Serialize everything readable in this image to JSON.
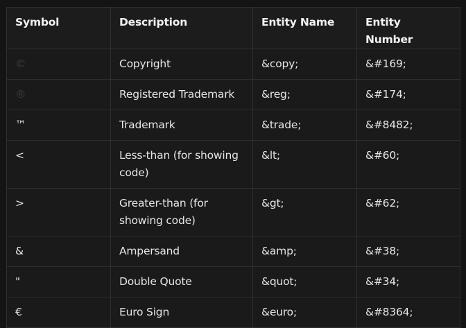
{
  "table": {
    "headers": [
      "Symbol",
      "Description",
      "Entity Name",
      "Entity Number"
    ],
    "rows": [
      {
        "symbol": "©",
        "description": "Copyright",
        "entity_name": "&copy;",
        "entity_number": "&#169;"
      },
      {
        "symbol": "®",
        "description": "Registered Trademark",
        "entity_name": "&reg;",
        "entity_number": "&#174;"
      },
      {
        "symbol": "™",
        "description": "Trademark",
        "entity_name": "&trade;",
        "entity_number": "&#8482;"
      },
      {
        "symbol": "<",
        "description": "Less-than (for showing code)",
        "entity_name": "&lt;",
        "entity_number": "&#60;"
      },
      {
        "symbol": ">",
        "description": "Greater-than (for showing code)",
        "entity_name": "&gt;",
        "entity_number": "&#62;"
      },
      {
        "symbol": "&",
        "description": "Ampersand",
        "entity_name": "&amp;",
        "entity_number": "&#38;"
      },
      {
        "symbol": "\"",
        "description": "Double Quote",
        "entity_name": "&quot;",
        "entity_number": "&#34;"
      },
      {
        "symbol": "€",
        "description": "Euro Sign",
        "entity_name": "&euro;",
        "entity_number": "&#8364;"
      }
    ]
  }
}
